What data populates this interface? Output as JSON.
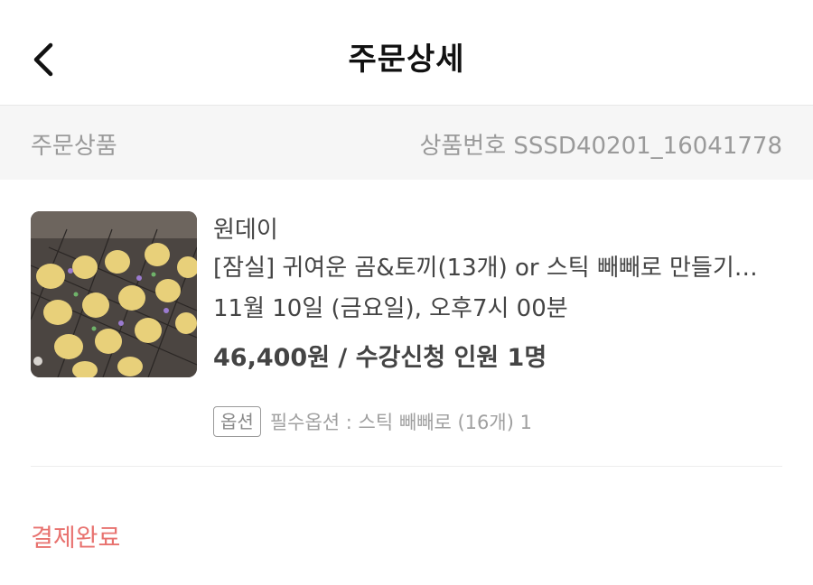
{
  "header": {
    "title": "주문상세"
  },
  "section": {
    "label": "주문상품",
    "product_no": "상품번호 SSSD40201_16041778"
  },
  "order": {
    "seller": "원데이",
    "product_name": "[잠실] 귀여운 곰&토끼(13개) or 스틱 빼빼로 만들기…",
    "schedule": "11월 10일 (금요일), 오후7시 00분",
    "price_line": "46,400원 / 수강신청 인원 1명",
    "option_badge": "옵션",
    "option_text": "필수옵션 : 스틱 빼빼로 (16개) 1"
  },
  "status": {
    "label": "결제완료",
    "color": "#e8726f"
  }
}
